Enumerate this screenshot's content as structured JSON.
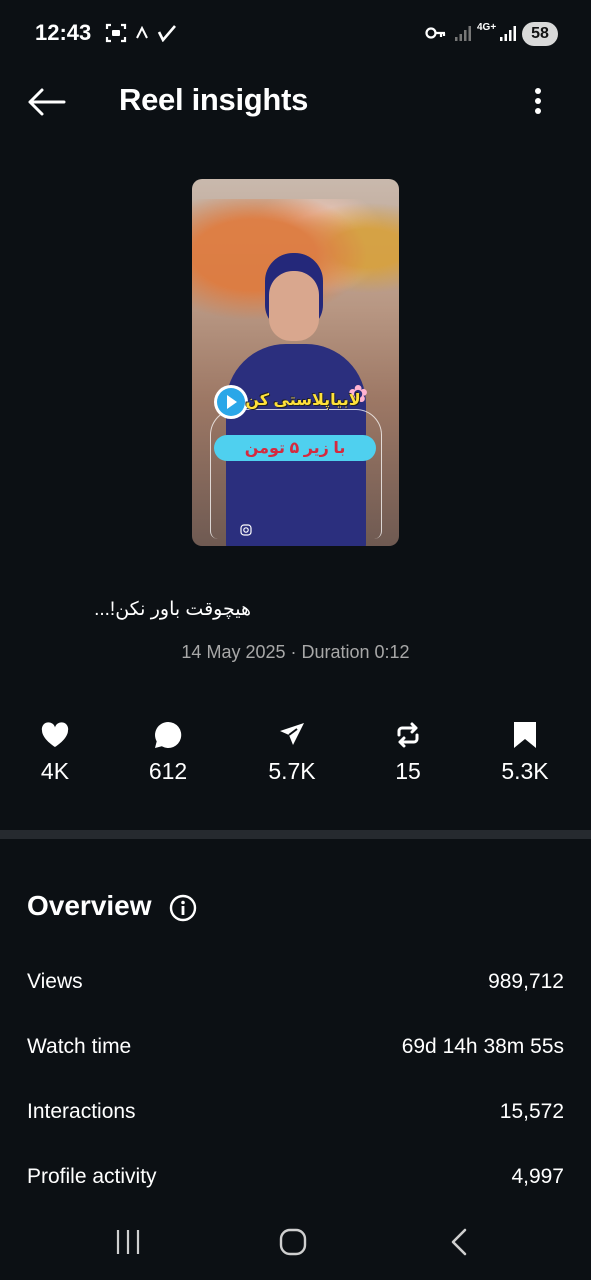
{
  "status_bar": {
    "time": "12:43",
    "network": "4G+",
    "battery": "58",
    "icons": [
      "screenshot-icon",
      "chevron-up-icon",
      "check-icon",
      "vpn-key-icon",
      "signal-icon",
      "signal-icon"
    ]
  },
  "header": {
    "title": "Reel insights",
    "back_icon": "arrow-left-icon",
    "more_icon": "more-vertical-icon"
  },
  "reel": {
    "thumbnail_text_top": "لابیاپلاستی کن",
    "thumbnail_text_pill": "با زیر ۵ تومن",
    "caption": "هیچوقت باور نکن!...",
    "meta": "14 May 2025 · Duration 0:12"
  },
  "stats": [
    {
      "icon": "heart-icon",
      "value": "4K"
    },
    {
      "icon": "comment-icon",
      "value": "612"
    },
    {
      "icon": "share-icon",
      "value": "5.7K"
    },
    {
      "icon": "repost-icon",
      "value": "15"
    },
    {
      "icon": "bookmark-icon",
      "value": "5.3K"
    }
  ],
  "overview": {
    "title": "Overview",
    "rows": [
      {
        "label": "Views",
        "value": "989,712"
      },
      {
        "label": "Watch time",
        "value": "69d 14h 38m 55s"
      },
      {
        "label": "Interactions",
        "value": "15,572"
      },
      {
        "label": "Profile activity",
        "value": "4,997"
      }
    ]
  },
  "nav_bar": [
    "recent-apps-icon",
    "home-icon",
    "back-icon"
  ],
  "colors": {
    "background": "#0c1014",
    "text": "#f5f5f5",
    "muted": "#a8a8a8",
    "divider": "#262a2f"
  }
}
